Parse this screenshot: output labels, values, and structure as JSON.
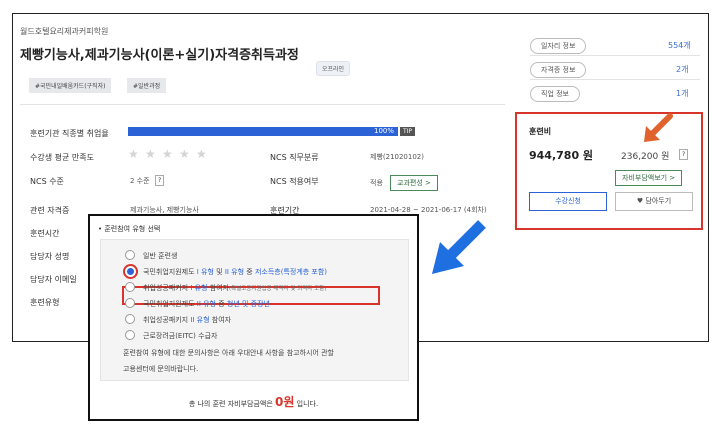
{
  "course": {
    "school": "월드호텔요리제과커피학원",
    "title": "제빵기능사,제과기능사(이론+실기)자격증취득과정",
    "mode_badge": "오프라인",
    "tags": [
      "#국민내일배움카드(구직자)",
      "#일반과정"
    ]
  },
  "right_info": [
    {
      "label": "일자리 정보",
      "value": "554개"
    },
    {
      "label": "자격증 정보",
      "value": "2개"
    },
    {
      "label": "직업 정보",
      "value": "1개"
    }
  ],
  "details": {
    "employment_rate_label": "훈련기관 직종별 취업율",
    "employment_rate_text": "100%",
    "employment_rate_value": 100,
    "tip_label": "TIP",
    "satisfaction_label": "수강생 평균 만족도",
    "satisfaction_stars": 0,
    "ncs_level_label": "NCS 수준",
    "ncs_level_value": "2 수준",
    "ncs_duty_label": "NCS 직무분류",
    "ncs_duty_value": "제빵(21020102)",
    "ncs_apply_label": "NCS 적용여부",
    "ncs_apply_value": "적용",
    "curriculum_button": "교과편성 >",
    "cert_label": "관련 자격증",
    "cert_value": "제과기능사, 제빵기능사",
    "period_label": "훈련기간",
    "period_value": "2021-04-28 ~ 2021-06-17 (4회차)",
    "hours_label": "훈련시간",
    "manager_label": "담당자 성명",
    "email_label": "담당자 이메일",
    "type_label": "훈련유형",
    "question_mark": "?"
  },
  "fee": {
    "title": "훈련비",
    "amount": "944,780 원",
    "self_pay": "236,200 원",
    "self_pay_button": "자비부담액보기 >",
    "apply_button": "수강신청",
    "wish_button": "담아두기"
  },
  "popup": {
    "title": "훈련참여 유형 선택",
    "options": [
      {
        "parts": [
          {
            "t": "일반 훈련생",
            "c": ""
          }
        ]
      },
      {
        "parts": [
          {
            "t": "국민취업지원제도 ",
            "c": ""
          },
          {
            "t": "I 유형",
            "c": "blue"
          },
          {
            "t": " 및 ",
            "c": ""
          },
          {
            "t": "II 유형",
            "c": "blue"
          },
          {
            "t": " 중 ",
            "c": ""
          },
          {
            "t": "저소득층",
            "c": "blue"
          },
          {
            "t": "(특정계층 포함)",
            "c": "blue"
          }
        ]
      },
      {
        "parts": [
          {
            "t": "취업성공패키지 ",
            "c": ""
          },
          {
            "t": "I 유형",
            "c": "blue"
          },
          {
            "t": " 참여자",
            "c": ""
          },
          {
            "t": "(특별고용지원업종 재직자 및 퇴직자 포함)",
            "c": "small"
          }
        ]
      },
      {
        "parts": [
          {
            "t": "국민취업지원제도 ",
            "c": ""
          },
          {
            "t": "II 유형",
            "c": "blue"
          },
          {
            "t": " 중 ",
            "c": ""
          },
          {
            "t": "청년 및 중장년",
            "c": "blue"
          }
        ]
      },
      {
        "parts": [
          {
            "t": "취업성공패키지 ",
            "c": ""
          },
          {
            "t": "II 유형",
            "c": "blue"
          },
          {
            "t": " 참여자",
            "c": ""
          }
        ]
      },
      {
        "parts": [
          {
            "t": "근로장려금(EITC) 수급자",
            "c": ""
          }
        ]
      }
    ],
    "selected_index": 1,
    "notice_line1": "훈련참여 유형에 대한 문의사항은 아래 우대안내 사항을 참고하시어 관할",
    "notice_line2": "고용센터에 문의바랍니다.",
    "total_prefix": "총 나의 훈련 자비부담금액은",
    "total_amount": "0원",
    "total_suffix": "입니다."
  },
  "colors": {
    "accent_blue": "#2b62d6",
    "highlight_red": "#d9342b",
    "arrow_blue": "#1e6fe0",
    "arrow_orange": "#e0622c"
  }
}
